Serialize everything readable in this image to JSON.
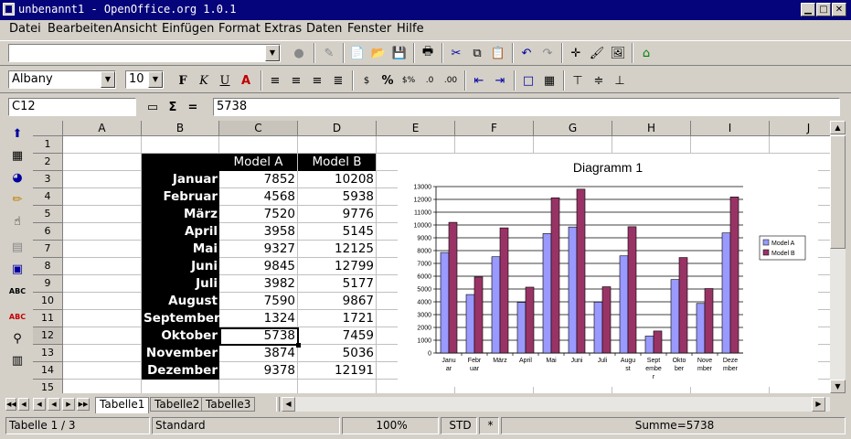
{
  "window": {
    "title": "unbenannt1 - OpenOffice.org 1.0.1"
  },
  "menu": [
    "Datei",
    "Bearbeiten",
    "Ansicht",
    "Einfügen",
    "Format",
    "Extras",
    "Daten",
    "Fenster",
    "Hilfe"
  ],
  "formatting": {
    "font_name": "Albany",
    "font_size": "10"
  },
  "formula_bar": {
    "cell_ref": "C12",
    "sum_symbol": "Σ",
    "equals": "=",
    "content": "5738"
  },
  "columns": [
    "A",
    "B",
    "C",
    "D",
    "E",
    "F",
    "G",
    "H",
    "I",
    "J"
  ],
  "rows": [
    "1",
    "2",
    "3",
    "4",
    "5",
    "6",
    "7",
    "8",
    "9",
    "10",
    "11",
    "12",
    "13",
    "14",
    "15"
  ],
  "table": {
    "headers": [
      "Model A",
      "Model B"
    ],
    "rows": [
      {
        "month": "Januar",
        "a": "7852",
        "b": "10208"
      },
      {
        "month": "Februar",
        "a": "4568",
        "b": "5938"
      },
      {
        "month": "März",
        "a": "7520",
        "b": "9776"
      },
      {
        "month": "April",
        "a": "3958",
        "b": "5145"
      },
      {
        "month": "Mai",
        "a": "9327",
        "b": "12125"
      },
      {
        "month": "Juni",
        "a": "9845",
        "b": "12799"
      },
      {
        "month": "Juli",
        "a": "3982",
        "b": "5177"
      },
      {
        "month": "August",
        "a": "7590",
        "b": "9867"
      },
      {
        "month": "September",
        "a": "1324",
        "b": "1721"
      },
      {
        "month": "Oktober",
        "a": "5738",
        "b": "7459"
      },
      {
        "month": "November",
        "a": "3874",
        "b": "5036"
      },
      {
        "month": "Dezember",
        "a": "9378",
        "b": "12191"
      }
    ]
  },
  "chart_data": {
    "type": "bar",
    "title": "Diagramm 1",
    "categories": [
      "Januar",
      "Februar",
      "März",
      "April",
      "Mai",
      "Juni",
      "Juli",
      "August",
      "September",
      "Oktober",
      "November",
      "Dezember"
    ],
    "category_labels": [
      [
        "Janu",
        "ar"
      ],
      [
        "Febr",
        "uar"
      ],
      [
        "März"
      ],
      [
        "April"
      ],
      [
        "Mai"
      ],
      [
        "Juni"
      ],
      [
        "Juli"
      ],
      [
        "Augu",
        "st"
      ],
      [
        "Sept",
        "embe",
        "r"
      ],
      [
        "Okto",
        "ber"
      ],
      [
        "Nove",
        "mber"
      ],
      [
        "Deze",
        "mber"
      ]
    ],
    "series": [
      {
        "name": "Model A",
        "color": "#9999ff",
        "values": [
          7852,
          4568,
          7520,
          3958,
          9327,
          9845,
          3982,
          7590,
          1324,
          5738,
          3874,
          9378
        ]
      },
      {
        "name": "Model B",
        "color": "#993366",
        "values": [
          10208,
          5938,
          9776,
          5145,
          12125,
          12799,
          5177,
          9867,
          1721,
          7459,
          5036,
          12191
        ]
      }
    ],
    "ylim": [
      0,
      13000
    ],
    "yticks": [
      "0",
      "1000",
      "2000",
      "3000",
      "4000",
      "5000",
      "6000",
      "7000",
      "8000",
      "9000",
      "10000",
      "11000",
      "12000",
      "13000"
    ],
    "grid": true,
    "legend": "right"
  },
  "sheet_tabs": [
    "Tabelle1",
    "Tabelle2",
    "Tabelle3"
  ],
  "status": {
    "sheet": "Tabelle 1 / 3",
    "style": "Standard",
    "zoom": "100%",
    "mode": "STD",
    "modified": "*",
    "sum": "Summe=5738"
  }
}
